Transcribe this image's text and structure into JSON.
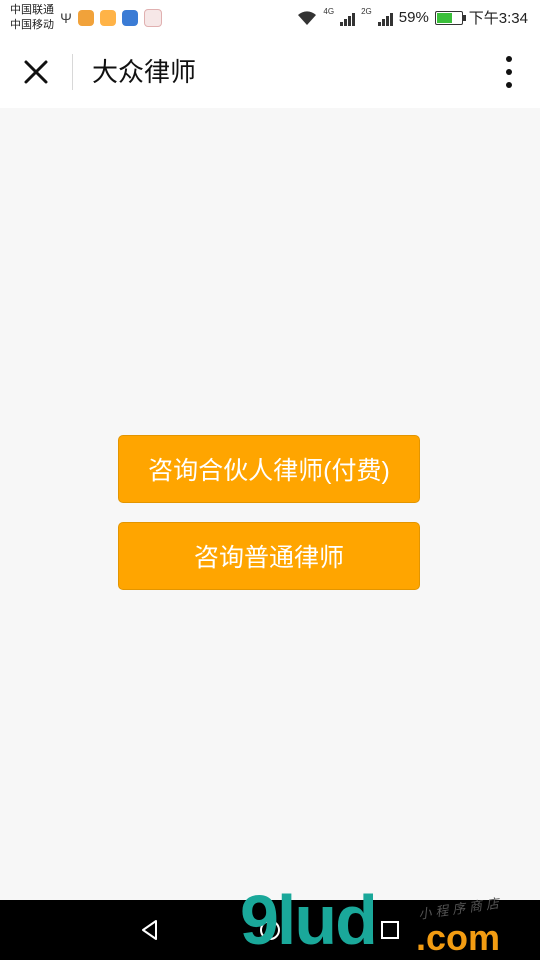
{
  "status_bar": {
    "carrier_1": "中国联通",
    "carrier_2": "中国移动",
    "battery_percent": "59%",
    "battery_level": 0.59,
    "time": "下午3:34",
    "net_1": "4G",
    "net_2": "2G"
  },
  "header": {
    "title": "大众律师"
  },
  "main": {
    "paid_button": "咨询合伙人律师(付费)",
    "normal_button": "咨询普通律师",
    "accent_color": "#ffa500"
  },
  "watermark": {
    "logo": "9lud",
    "com": ".com",
    "tagline": "小程序商店"
  }
}
